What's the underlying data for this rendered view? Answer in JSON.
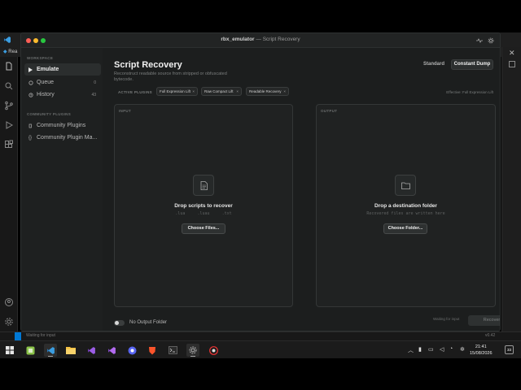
{
  "vscode": {
    "tab_label": "Rea"
  },
  "app": {
    "title_main": "rbx_emulator",
    "title_separator": "—",
    "title_page": "Script Recovery"
  },
  "sidebar": {
    "workspace_label": "WORKSPACE",
    "items": [
      {
        "label": "Emulate",
        "icon": "play-icon",
        "count": ""
      },
      {
        "label": "Queue",
        "icon": "circle-icon",
        "count": "0"
      },
      {
        "label": "History",
        "icon": "history-icon",
        "count": "43"
      }
    ],
    "community_label": "COMMUNITY PLUGINS",
    "community_items": [
      {
        "label": "Community Plugins",
        "icon": "puzzle-icon"
      },
      {
        "label": "Community Plugin Ma...",
        "icon": "code-braces-icon"
      }
    ]
  },
  "main": {
    "title": "Script Recovery",
    "subtitle": "Reconstruct readable source from stripped or obfuscated bytecode.",
    "mode_standard": "Standard",
    "mode_constant": "Constant Dump",
    "plugins_label": "ACTIVE PLUGINS",
    "plugins": [
      "Full Expression Lift",
      "Raw Compact Lift",
      "Readable Recovery"
    ],
    "chip_close": "×",
    "effective": "Effective: Full Expression Lift",
    "input_panel": {
      "label": "INPUT",
      "title": "Drop scripts to recover",
      "subtitle": ".lua     .luau     .txt",
      "button": "Choose Files..."
    },
    "output_panel": {
      "label": "OUTPUT",
      "title": "Drop a destination folder",
      "subtitle": "Recovered files are written here",
      "button": "Choose Folder..."
    },
    "toggle_label": "No Output Folder",
    "status": "Waiting for input",
    "recover_button": "Recover"
  },
  "statusbar": {
    "left_text": "Waiting for input",
    "right_text": "v0.42"
  },
  "taskbar": {
    "time": "21:41",
    "date": "15/08/2026",
    "notifications": "33"
  }
}
